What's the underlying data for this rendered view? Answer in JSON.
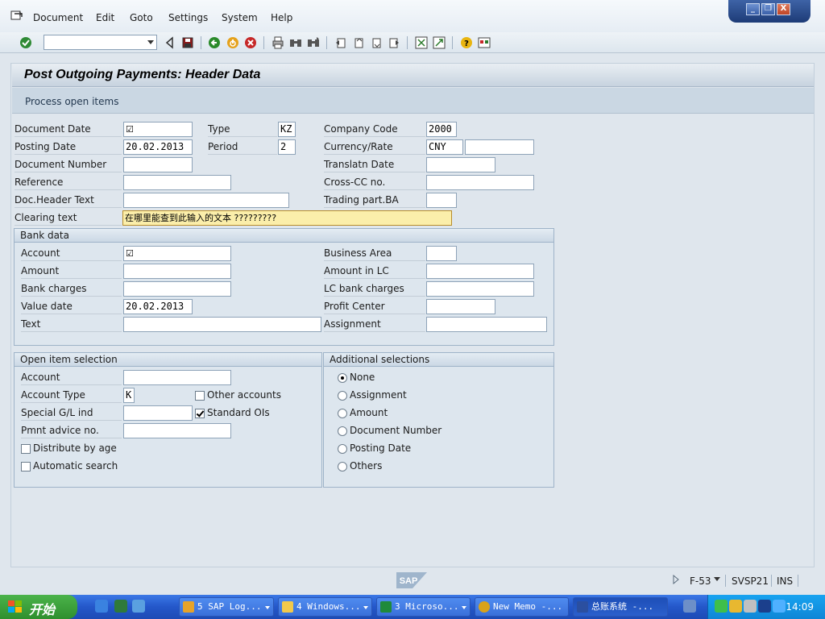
{
  "menu": [
    "Document",
    "Edit",
    "Goto",
    "Settings",
    "System",
    "Help"
  ],
  "window_controls": {
    "minimize": "_",
    "restore": "❐",
    "close": "X"
  },
  "toolbar": {
    "command_field": "",
    "icons": [
      "enter-icon",
      "back-icon",
      "save-icon",
      "back-green-icon",
      "exit-icon",
      "cancel-icon",
      "print-icon",
      "find-icon",
      "find-next-icon",
      "first-page-icon",
      "previous-page-icon",
      "next-page-icon",
      "last-page-icon",
      "create-session-icon",
      "shortcut-icon",
      "help-icon",
      "layout-icon"
    ]
  },
  "title": "Post Outgoing Payments: Header Data",
  "app_toolbar": {
    "process_open_items": "Process open items"
  },
  "header": {
    "document_date_label": "Document Date",
    "document_date": "☑",
    "type_label": "Type",
    "type": "KZ",
    "company_code_label": "Company Code",
    "company_code": "2000",
    "posting_date_label": "Posting Date",
    "posting_date": "20.02.2013",
    "period_label": "Period",
    "period": "2",
    "currency_label": "Currency/Rate",
    "currency": "CNY",
    "rate": "",
    "document_number_label": "Document Number",
    "document_number": "",
    "translatn_date_label": "Translatn Date",
    "translatn_date": "",
    "reference_label": "Reference",
    "reference": "",
    "cross_cc_label": "Cross-CC no.",
    "cross_cc": "",
    "doc_header_text_label": "Doc.Header Text",
    "doc_header_text": "",
    "trading_part_label": "Trading part.BA",
    "trading_part": "",
    "clearing_text_label": "Clearing text",
    "clearing_text": "在哪里能查到此输入的文本 ?????????"
  },
  "bank_data": {
    "title": "Bank data",
    "account_label": "Account",
    "account": "☑",
    "business_area_label": "Business Area",
    "business_area": "",
    "amount_label": "Amount",
    "amount": "",
    "amount_lc_label": "Amount in LC",
    "amount_lc": "",
    "bank_charges_label": "Bank charges",
    "bank_charges": "",
    "lc_bank_charges_label": "LC bank charges",
    "lc_bank_charges": "",
    "value_date_label": "Value date",
    "value_date": "20.02.2013",
    "profit_center_label": "Profit Center",
    "profit_center": "",
    "text_label": "Text",
    "text": "",
    "assignment_label": "Assignment",
    "assignment": ""
  },
  "open_item_selection": {
    "title": "Open item selection",
    "account_label": "Account",
    "account": "",
    "account_type_label": "Account Type",
    "account_type": "K",
    "other_accounts_label": "Other accounts",
    "other_accounts": false,
    "special_gl_label": "Special G/L ind",
    "special_gl": "",
    "standard_ois_label": "Standard OIs",
    "standard_ois": true,
    "pmnt_advice_label": "Pmnt advice no.",
    "pmnt_advice": "",
    "distribute_by_age_label": "Distribute by age",
    "automatic_search_label": "Automatic search"
  },
  "additional_selections": {
    "title": "Additional selections",
    "options": [
      "None",
      "Assignment",
      "Amount",
      "Document Number",
      "Posting Date",
      "Others"
    ],
    "selected": "None"
  },
  "status_bar": {
    "logo": "SAP",
    "transaction": "F-53",
    "system": "SVSP21",
    "mode": "INS"
  },
  "taskbar": {
    "start": "开始",
    "buttons": [
      "5 SAP Log...",
      "4 Windows...",
      "3 Microso...",
      "New Memo -...",
      "总账系统 -..."
    ],
    "clock": "14:09"
  }
}
